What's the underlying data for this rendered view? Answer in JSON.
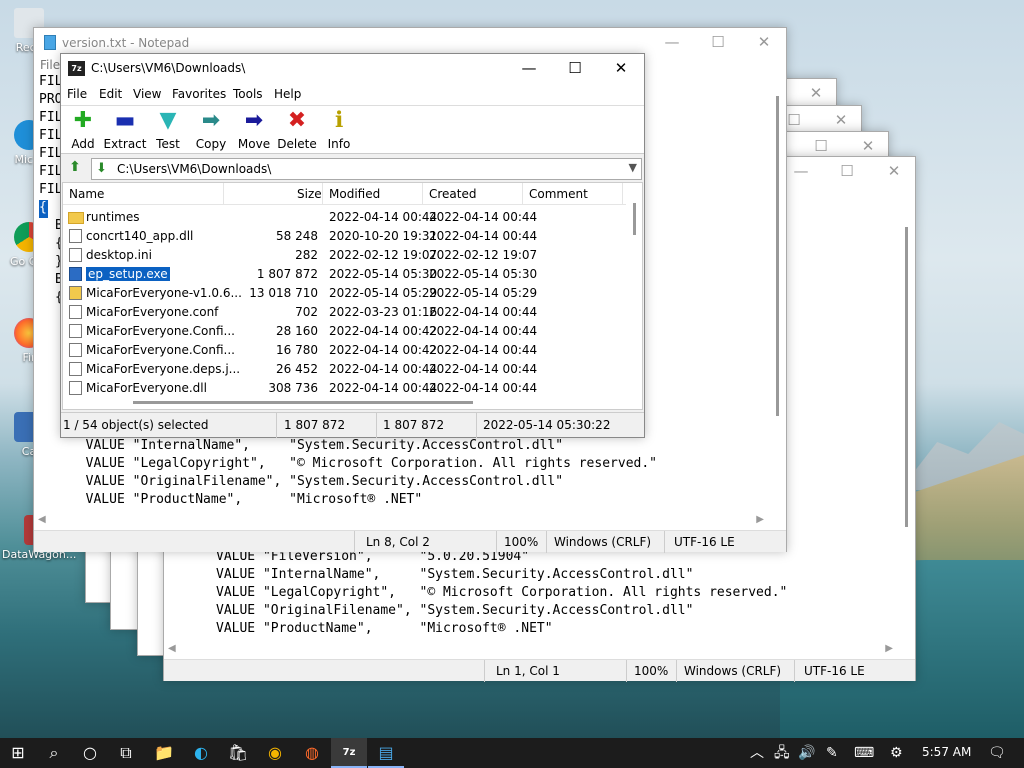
{
  "desktop": {
    "icons": [
      {
        "label": "Recy"
      },
      {
        "label": "Mic E"
      },
      {
        "label": "Go Chr"
      },
      {
        "label": "Fir"
      },
      {
        "label": "Ca"
      },
      {
        "label": "DataWagon..."
      }
    ]
  },
  "notepad_back": {
    "text_lines": [
      "VALUE \"FileVersion\",      \"5.0.20.51904\"",
      "VALUE \"InternalName\",     \"System.Security.AccessControl.dll\"",
      "VALUE \"LegalCopyright\",   \"© Microsoft Corporation. All rights reserved.\"",
      "VALUE \"OriginalFilename\", \"System.Security.AccessControl.dll\"",
      "VALUE \"ProductName\",      \"Microsoft® .NET\""
    ],
    "status": {
      "position": "Ln 1, Col 1",
      "zoom": "100%",
      "eol": "Windows (CRLF)",
      "encoding": "UTF-16 LE"
    }
  },
  "notepad_front": {
    "title": "version.txt - Notepad",
    "menu_first": "File",
    "left_fragments": [
      "FIL",
      "PRO",
      "FIL",
      "FIL",
      "FIL",
      "FIL",
      "FIL",
      "{",
      "B",
      "{",
      "}",
      "B",
      "{"
    ],
    "text_lines": [
      "  VALUE \"InternalName\",     \"System.Security.AccessControl.dll\"",
      "  VALUE \"LegalCopyright\",   \"© Microsoft Corporation. All rights reserved.\"",
      "  VALUE \"OriginalFilename\", \"System.Security.AccessControl.dll\"",
      "  VALUE \"ProductName\",      \"Microsoft® .NET\""
    ],
    "status": {
      "position": "Ln 8, Col 2",
      "zoom": "100%",
      "eol": "Windows (CRLF)",
      "encoding": "UTF-16 LE"
    }
  },
  "window_controls": {
    "minimize": "—",
    "maximize": "☐",
    "close": "✕"
  },
  "zip": {
    "logo": "7z",
    "title": "C:\\Users\\VM6\\Downloads\\",
    "menu": [
      "File",
      "Edit",
      "View",
      "Favorites",
      "Tools",
      "Help"
    ],
    "toolbar": [
      {
        "label": "Add",
        "glyph": "✚",
        "color": "#22aa22"
      },
      {
        "label": "Extract",
        "glyph": "▬",
        "color": "#1a2fb0"
      },
      {
        "label": "Test",
        "glyph": "▼",
        "color": "#2ab5b5"
      },
      {
        "label": "Copy",
        "glyph": "➡",
        "color": "#2a8a8a"
      },
      {
        "label": "Move",
        "glyph": "➡",
        "color": "#1a1a9a"
      },
      {
        "label": "Delete",
        "glyph": "✖",
        "color": "#d42020"
      },
      {
        "label": "Info",
        "glyph": "ℹ",
        "color": "#b8a000"
      }
    ],
    "address": "C:\\Users\\VM6\\Downloads\\",
    "columns": {
      "name": "Name",
      "size": "Size",
      "modified": "Modified",
      "created": "Created",
      "comment": "Comment"
    },
    "files": [
      {
        "name": "runtimes",
        "size": "",
        "modified": "2022-04-14 00:44",
        "created": "2022-04-14 00:44",
        "type": "folder"
      },
      {
        "name": "concrt140_app.dll",
        "size": "58 248",
        "modified": "2020-10-20 19:31",
        "created": "2022-04-14 00:44",
        "type": "file"
      },
      {
        "name": "desktop.ini",
        "size": "282",
        "modified": "2022-02-12 19:07",
        "created": "2022-02-12 19:07",
        "type": "file"
      },
      {
        "name": "ep_setup.exe",
        "size": "1 807 872",
        "modified": "2022-05-14 05:30",
        "created": "2022-05-14 05:30",
        "type": "exe",
        "selected": true
      },
      {
        "name": "MicaForEveryone-v1.0.6...",
        "size": "13 018 710",
        "modified": "2022-05-14 05:29",
        "created": "2022-05-14 05:29",
        "type": "zip"
      },
      {
        "name": "MicaForEveryone.conf",
        "size": "702",
        "modified": "2022-03-23 01:16",
        "created": "2022-04-14 00:44",
        "type": "file"
      },
      {
        "name": "MicaForEveryone.Confi...",
        "size": "28 160",
        "modified": "2022-04-14 00:42",
        "created": "2022-04-14 00:44",
        "type": "file"
      },
      {
        "name": "MicaForEveryone.Confi...",
        "size": "16 780",
        "modified": "2022-04-14 00:42",
        "created": "2022-04-14 00:44",
        "type": "file"
      },
      {
        "name": "MicaForEveryone.deps.j...",
        "size": "26 452",
        "modified": "2022-04-14 00:44",
        "created": "2022-04-14 00:44",
        "type": "file"
      },
      {
        "name": "MicaForEveryone.dll",
        "size": "308 736",
        "modified": "2022-04-14 00:44",
        "created": "2022-04-14 00:44",
        "type": "file"
      }
    ],
    "status": {
      "selection": "1 / 54 object(s) selected",
      "size": "1 807 872",
      "packed": "1 807 872",
      "date": "2022-05-14 05:30:22"
    }
  },
  "taskbar": {
    "start": "⊞",
    "search": "⌕",
    "cortana": "○",
    "taskview": "⧉",
    "apps": [
      "📁",
      "◐",
      "🛍",
      "◉",
      "◍",
      "7z",
      "▤"
    ],
    "tray": {
      "chevron": "︿",
      "network": "🖧",
      "volume": "🔊",
      "pen": "✎",
      "keyboard": "⌨",
      "settings": "⚙",
      "notifications": "🗨"
    },
    "time": "5:57 AM"
  }
}
